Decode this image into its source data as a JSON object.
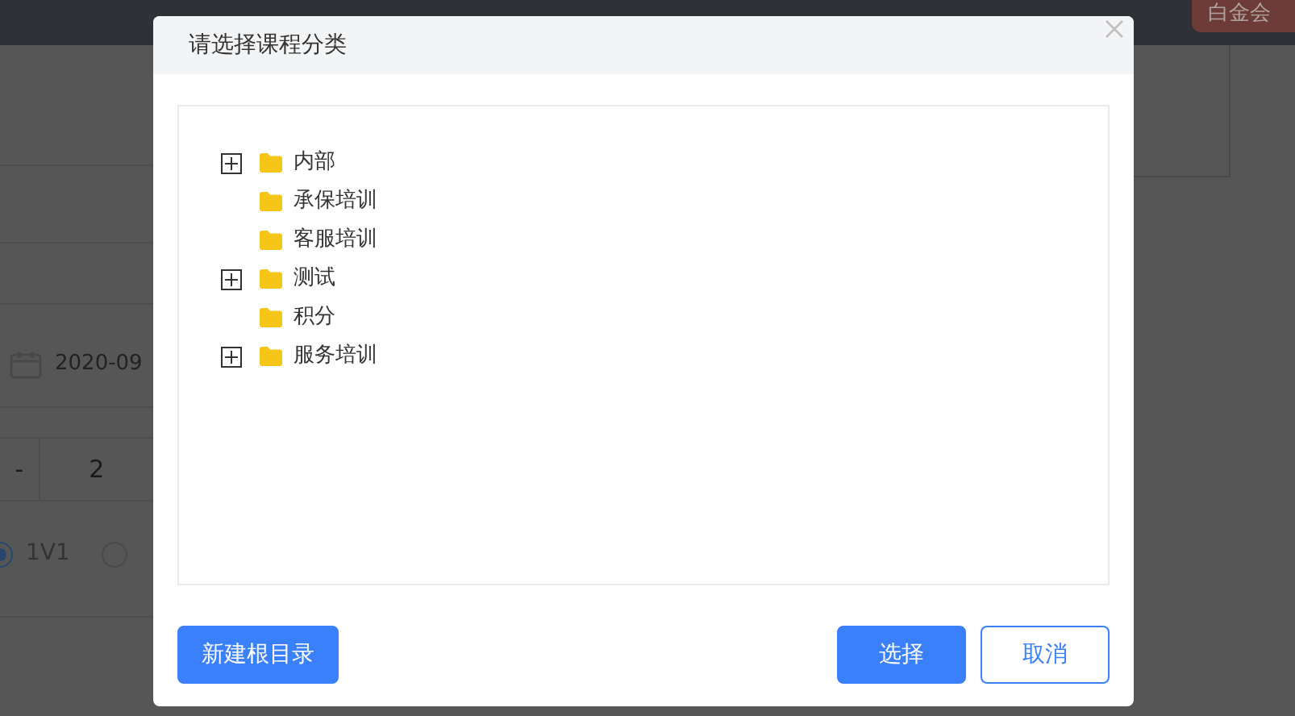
{
  "background": {
    "member_badge": "白金会",
    "date_value": "2020-09",
    "table_cells": [
      "-",
      "2"
    ],
    "radios": [
      {
        "label": "1V1",
        "selected": true
      },
      {
        "selected": false
      }
    ]
  },
  "dialog": {
    "title": "请选择课程分类",
    "tree": [
      {
        "label": "内部",
        "expandable": true
      },
      {
        "label": "承保培训",
        "expandable": false
      },
      {
        "label": "客服培训",
        "expandable": false
      },
      {
        "label": "测试",
        "expandable": true
      },
      {
        "label": "积分",
        "expandable": false
      },
      {
        "label": "服务培训",
        "expandable": true
      }
    ],
    "buttons": [
      {
        "label": "新建根目录",
        "kind": "primary"
      },
      {
        "label": "选择",
        "kind": "primary"
      },
      {
        "label": "取消",
        "kind": "outline"
      }
    ]
  }
}
